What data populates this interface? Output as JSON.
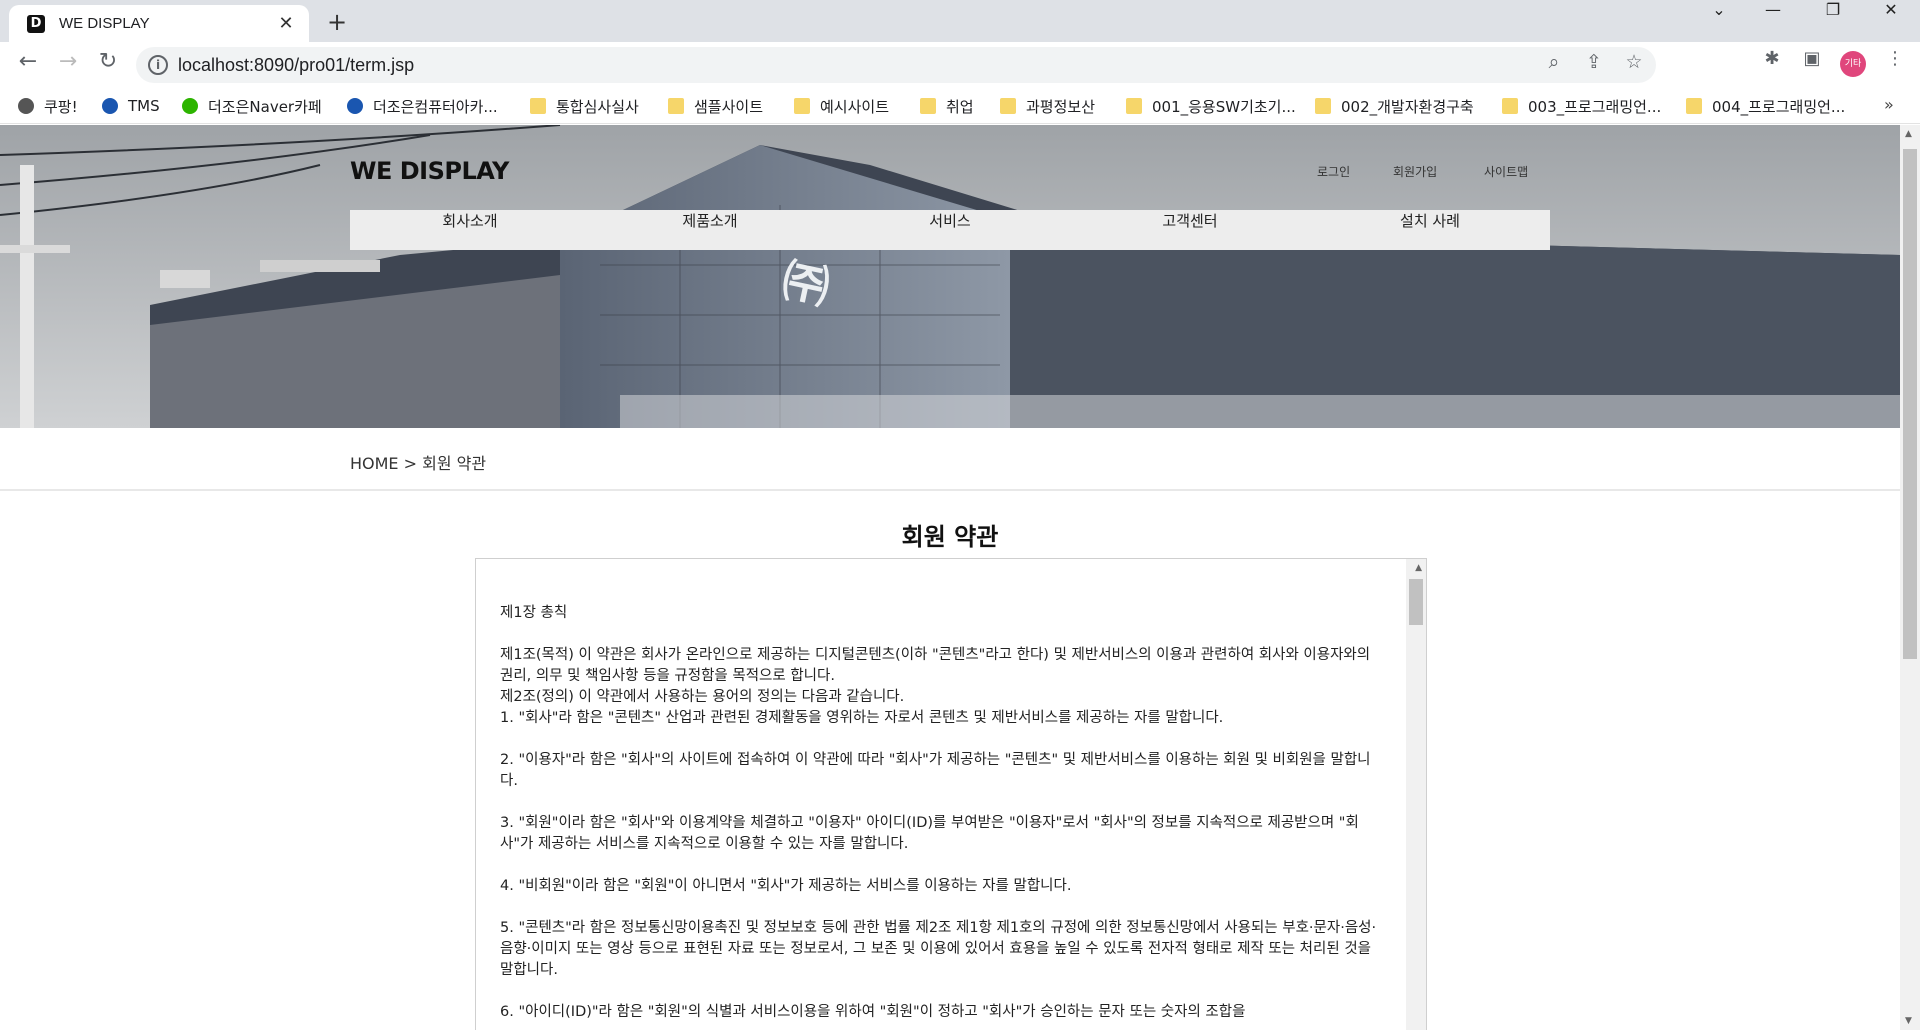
{
  "browser": {
    "tab_title": "WE DISPLAY",
    "tab_favicon": "D",
    "tab_close": "✕",
    "new_tab": "+",
    "url": "localhost:8090/pro01/term.jsp",
    "profile_label": "기타"
  },
  "bookmarks": [
    {
      "label": "쿠팡!",
      "icon": "globe-icon",
      "color": "#555555"
    },
    {
      "label": "TMS",
      "icon": "tms-logo-icon",
      "color": "#1a56b0"
    },
    {
      "label": "더조은Naver카페",
      "icon": "naver-cafe-icon",
      "color": "#2db400"
    },
    {
      "label": "더조은컴퓨터아카...",
      "icon": "academy-logo-icon",
      "color": "#1a56b0"
    },
    {
      "label": "통합심사실사",
      "icon": "folder-icon",
      "color": "#f6d66a"
    },
    {
      "label": "샘플사이트",
      "icon": "folder-icon",
      "color": "#f6d66a"
    },
    {
      "label": "예시사이트",
      "icon": "folder-icon",
      "color": "#f6d66a"
    },
    {
      "label": "취업",
      "icon": "folder-icon",
      "color": "#f6d66a"
    },
    {
      "label": "과평정보산",
      "icon": "folder-icon",
      "color": "#f6d66a"
    },
    {
      "label": "001_응용SW기초기...",
      "icon": "folder-icon",
      "color": "#f6d66a"
    },
    {
      "label": "002_개발자환경구축",
      "icon": "folder-icon",
      "color": "#f6d66a"
    },
    {
      "label": "003_프로그래밍언...",
      "icon": "folder-icon",
      "color": "#f6d66a"
    },
    {
      "label": "004_프로그래밍언...",
      "icon": "folder-icon",
      "color": "#f6d66a"
    }
  ],
  "bookmarks_more": "»",
  "site": {
    "logo": "WE DISPLAY",
    "util_links": [
      "로그인",
      "회원가입",
      "사이트맵"
    ],
    "nav": [
      "회사소개",
      "제품소개",
      "서비스",
      "고객센터",
      "설치 사례"
    ],
    "breadcrumb": "HOME > 회원 약관",
    "title": "회원 약관"
  },
  "terms": [
    "제1장 총칙",
    "제1조(목적) 이 약관은 회사가 온라인으로 제공하는 디지털콘텐츠(이하 \"콘텐츠\"라고 한다) 및 제반서비스의 이용과 관련하여 회사와 이용자와의 권리, 의무 및 책임사항 등을 규정함을 목적으로 합니다.",
    "제2조(정의) 이 약관에서 사용하는 용어의 정의는 다음과 같습니다.",
    "1. \"회사\"라 함은 \"콘텐츠\" 산업과 관련된 경제활동을 영위하는 자로서 콘텐츠 및 제반서비스를 제공하는 자를 말합니다.",
    "2. \"이용자\"라 함은 \"회사\"의 사이트에 접속하여 이 약관에 따라 \"회사\"가 제공하는 \"콘텐츠\" 및 제반서비스를 이용하는 회원 및 비회원을 말합니다.",
    "3. \"회원\"이라 함은 \"회사\"와 이용계약을 체결하고 \"이용자\" 아이디(ID)를 부여받은 \"이용자\"로서 \"회사\"의 정보를 지속적으로 제공받으며 \"회사\"가 제공하는 서비스를 지속적으로 이용할 수 있는 자를 말합니다.",
    "4. \"비회원\"이라 함은 \"회원\"이 아니면서 \"회사\"가 제공하는 서비스를 이용하는 자를 말합니다.",
    "5. \"콘텐츠\"라 함은 정보통신망이용촉진 및 정보보호 등에 관한 법률 제2조 제1항 제1호의 규정에 의한 정보통신망에서 사용되는 부호·문자·음성·음향·이미지 또는 영상 등으로 표현된 자료 또는 정보로서, 그 보존 및 이용에 있어서 효용을 높일 수 있도록 전자적 형태로 제작 또는 처리된 것을 말합니다.",
    "6. \"아이디(ID)\"라 함은 \"회원\"의 식별과 서비스이용을 위하여 \"회원\"이 정하고 \"회사\"가 승인하는 문자 또는 숫자의 조합을"
  ]
}
